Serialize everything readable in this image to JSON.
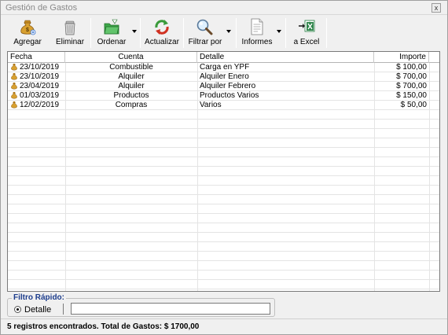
{
  "window": {
    "title": "Gestión de Gastos",
    "close_label": "x"
  },
  "toolbar": {
    "agregar": "Agregar",
    "eliminar": "Eliminar",
    "ordenar": "Ordenar",
    "actualizar": "Actualizar",
    "filtrar": "Filtrar por",
    "informes": "Informes",
    "excel": "a Excel"
  },
  "table": {
    "columns": [
      "Fecha",
      "Cuenta",
      "Detalle",
      "Importe"
    ],
    "rows": [
      {
        "fecha": "23/10/2019",
        "cuenta": "Combustible",
        "detalle": "Carga en YPF",
        "importe": "$ 100,00"
      },
      {
        "fecha": "23/10/2019",
        "cuenta": "Alquiler",
        "detalle": "Alquiler Enero",
        "importe": "$ 700,00"
      },
      {
        "fecha": "23/04/2019",
        "cuenta": "Alquiler",
        "detalle": "Alquiler Febrero",
        "importe": "$ 700,00"
      },
      {
        "fecha": "01/03/2019",
        "cuenta": "Productos",
        "detalle": "Productos Varios",
        "importe": "$ 150,00"
      },
      {
        "fecha": "12/02/2019",
        "cuenta": "Compras",
        "detalle": "Varios",
        "importe": "$ 50,00"
      }
    ]
  },
  "filter": {
    "legend": "Filtro Rápido:",
    "option": "Detalle",
    "value": ""
  },
  "status": {
    "text": "5 registros encontrados.   Total de Gastos: $ 1700,00"
  },
  "icons": {
    "agregar": "money-bag-add-icon",
    "eliminar": "trash-can-icon",
    "ordenar": "folder-sort-icon",
    "actualizar": "refresh-icon",
    "filtrar": "magnifier-icon",
    "informes": "document-icon",
    "excel": "excel-export-icon",
    "row": "money-bag-icon"
  },
  "colors": {
    "accent": "#1c3c8c",
    "excel": "#1e7b3c"
  }
}
